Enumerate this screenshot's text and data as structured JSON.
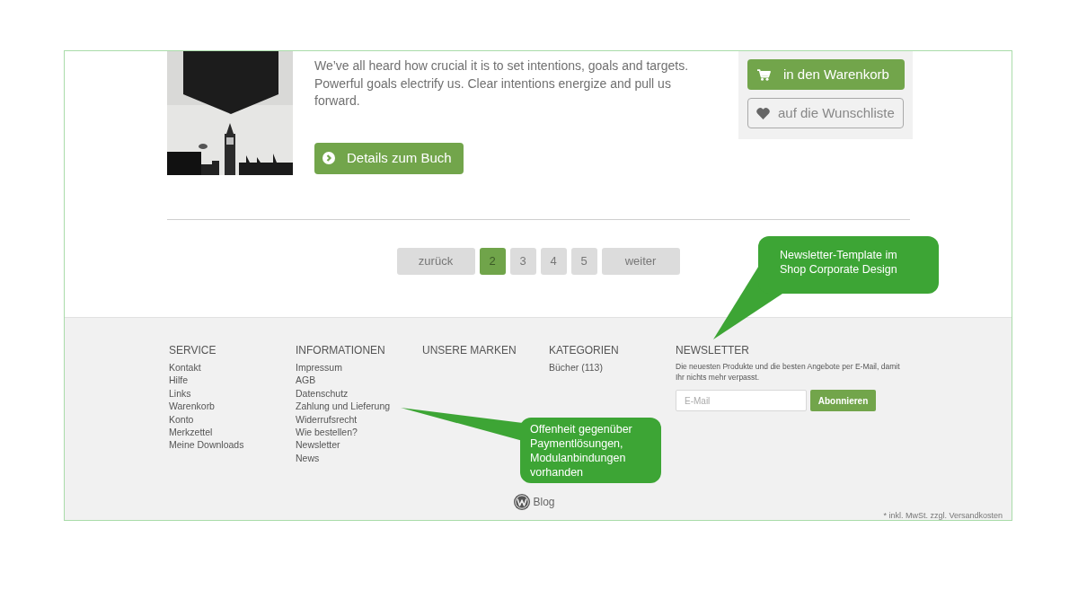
{
  "product": {
    "description": "We’ve all heard how crucial it is to set intentions, goals and targets. Powerful goals electrify us. Clear intentions energize and pull us forward.",
    "details_button": "Details zum Buch",
    "cart_button": "in den Warenkorb",
    "wishlist_button": "auf die Wunschliste"
  },
  "pagination": [
    {
      "label": "zurück",
      "kind": "prev",
      "selected": false
    },
    {
      "label": "2",
      "kind": "page",
      "selected": true
    },
    {
      "label": "3",
      "kind": "page",
      "selected": false
    },
    {
      "label": "4",
      "kind": "page",
      "selected": false
    },
    {
      "label": "5",
      "kind": "page",
      "selected": false
    },
    {
      "label": "weiter",
      "kind": "next",
      "selected": false
    }
  ],
  "footer": {
    "columns": [
      {
        "title": "SERVICE",
        "links": [
          "Kontakt",
          "Hilfe",
          "Links",
          "Warenkorb",
          "Konto",
          "Merkzettel",
          "Meine Downloads"
        ]
      },
      {
        "title": "INFORMATIONEN",
        "links": [
          "Impressum",
          "AGB",
          "Datenschutz",
          "Zahlung und Lieferung",
          "Widerrufsrecht",
          "Wie bestellen?",
          "Newsletter",
          "News"
        ]
      },
      {
        "title": "UNSERE MARKEN"
      },
      {
        "title": "KATEGORIEN",
        "links": [
          "Bücher (113)"
        ]
      }
    ],
    "newsletter": {
      "title": "NEWSLETTER",
      "text": "Die neuesten Produkte und die besten Angebote per E-Mail, damit Ihr nichts mehr verpasst.",
      "placeholder": "E-Mail",
      "button": "Abonnieren"
    },
    "blog_link": "Blog",
    "footnote": "* inkl. MwSt. zzgl. Versandkosten"
  },
  "callouts": [
    {
      "text": "Newsletter-Template im Shop Corporate Design"
    },
    {
      "text": "Offenheit gegenüber Paymentlösungen, Modulanbindungen vorhanden"
    }
  ]
}
